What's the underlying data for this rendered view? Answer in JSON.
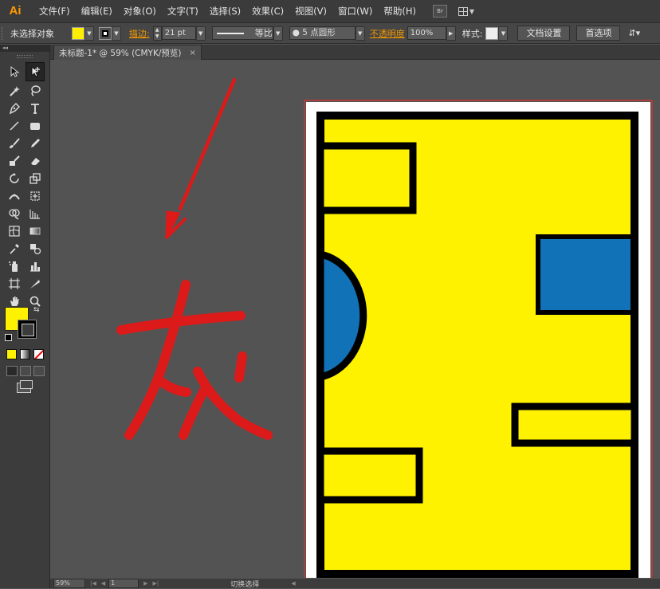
{
  "app": {
    "logo": "Ai"
  },
  "menu": [
    "文件(F)",
    "编辑(E)",
    "对象(O)",
    "文字(T)",
    "选择(S)",
    "效果(C)",
    "视图(V)",
    "窗口(W)",
    "帮助(H)"
  ],
  "menu_icons": {
    "bridge": "Br",
    "arrange": "arrange-documents-icon"
  },
  "control_bar": {
    "selection_label": "未选择对象",
    "fill_color": "#ffee00",
    "stroke_label": "描边:",
    "stroke_weight": "21 pt",
    "profile_label": "等比",
    "brush_label": "5 点圆形",
    "opacity_label": "不透明度",
    "opacity_value": "100%",
    "style_label": "样式:",
    "doc_setup_button": "文档设置",
    "preferences_button": "首选项"
  },
  "document_tab": {
    "title": "未标题-1* @ 59% (CMYK/预览)",
    "close": "×"
  },
  "tools_panel": {
    "collapse": "◂◂"
  },
  "canvas": {
    "annotation_text": "灰",
    "annotation_color": "#dd1a1a",
    "artboard": {
      "border_color": "#e03030",
      "paper": "#ffffff",
      "fill": "#fff200",
      "stroke": "#000000",
      "blue": "#1272b8"
    }
  },
  "status_bar": {
    "zoom": "59%",
    "page": "1",
    "status_text": "切换选择"
  }
}
